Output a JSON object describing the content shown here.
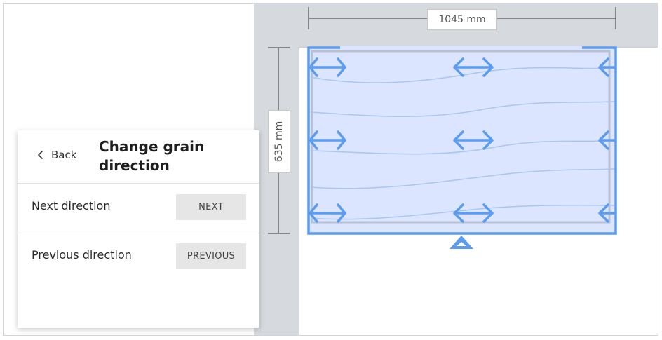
{
  "canvas": {
    "width_label": "1045 mm",
    "height_label": "635 mm",
    "accent_color": "#5b9cf0",
    "selection_fill": "#dbe5ff"
  },
  "panel": {
    "back_label": "Back",
    "title": "Change grain direction",
    "rows": [
      {
        "label": "Next direction",
        "button": "NEXT"
      },
      {
        "label": "Previous direction",
        "button": "PREVIOUS"
      }
    ]
  },
  "icons": {
    "back": "chevron-left-icon",
    "grain": "double-arrow-horizontal-icon",
    "pivot": "triangle-up-icon"
  }
}
